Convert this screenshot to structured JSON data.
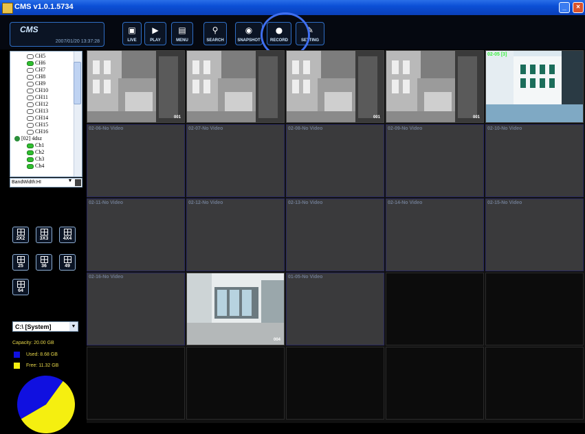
{
  "window": {
    "title": "CMS v1.0.1.5734"
  },
  "header": {
    "logo": "CMS",
    "datetime": "2007/01/20 13:37:28",
    "buttons": [
      {
        "label": "LIVE",
        "icon": "tv-icon"
      },
      {
        "label": "PLAY",
        "icon": "play-icon"
      },
      {
        "label": "MENU",
        "icon": "menu-icon"
      },
      {
        "label": "SEARCH",
        "icon": "search-icon"
      },
      {
        "label": "SNAPSHOT",
        "icon": "eye-icon"
      },
      {
        "label": "RECORD",
        "icon": "record-icon"
      },
      {
        "label": "SETTING",
        "icon": "settings-icon"
      }
    ]
  },
  "tree": {
    "items": [
      {
        "label": "CH5",
        "green": false
      },
      {
        "label": "CH6",
        "green": true
      },
      {
        "label": "CH7",
        "green": false
      },
      {
        "label": "CH8",
        "green": false
      },
      {
        "label": "CH9",
        "green": false
      },
      {
        "label": "CH10",
        "green": false
      },
      {
        "label": "CH11",
        "green": false
      },
      {
        "label": "CH12",
        "green": false
      },
      {
        "label": "CH13",
        "green": false
      },
      {
        "label": "CH14",
        "green": false
      },
      {
        "label": "CH15",
        "green": false
      },
      {
        "label": "CH16",
        "green": false
      },
      {
        "label": "[02] 4dsz",
        "dvr": true
      },
      {
        "label": "Ch1",
        "green": true
      },
      {
        "label": "Ch2",
        "green": true
      },
      {
        "label": "Ch3",
        "green": true
      },
      {
        "label": "Ch4",
        "green": true
      }
    ]
  },
  "bandwidth": {
    "label": "BandWidth:",
    "value": "HI"
  },
  "layout_buttons": [
    {
      "label": "2X2"
    },
    {
      "label": "3X3"
    },
    {
      "label": "4X4"
    },
    {
      "label": "25"
    },
    {
      "label": "36"
    },
    {
      "label": "49"
    },
    {
      "label": "64"
    }
  ],
  "drive": {
    "value": "C:\\ [System]"
  },
  "storage": {
    "capacity": "Capacity: 20.00 GB",
    "used": "Used: 8.68 GB",
    "free": "Free: 11.32 GB",
    "used_value": 8.68,
    "free_value": 11.32,
    "used_color": "#1010e0",
    "free_color": "#f5ef10"
  },
  "cells": [
    {
      "label": "",
      "type": "video",
      "num": "001"
    },
    {
      "label": "",
      "type": "video",
      "num": "",
      "selected": true
    },
    {
      "label": "",
      "type": "video",
      "num": "001"
    },
    {
      "label": "",
      "type": "video",
      "num": "001"
    },
    {
      "label": "02-05 [3]",
      "type": "video2",
      "num": ""
    },
    {
      "label": "02-06-No Video",
      "type": "nv"
    },
    {
      "label": "02-07-No Video",
      "type": "nv"
    },
    {
      "label": "02-08-No Video",
      "type": "nv"
    },
    {
      "label": "02-09-No Video",
      "type": "nv"
    },
    {
      "label": "02-10-No Video",
      "type": "nv"
    },
    {
      "label": "02-11-No Video",
      "type": "nv"
    },
    {
      "label": "02-12-No Video",
      "type": "nv"
    },
    {
      "label": "02-13-No Video",
      "type": "nv"
    },
    {
      "label": "02-14-No Video",
      "type": "nv"
    },
    {
      "label": "02-15-No Video",
      "type": "nv"
    },
    {
      "label": "02-16-No Video",
      "type": "nv"
    },
    {
      "label": "",
      "type": "video3",
      "num": "004"
    },
    {
      "label": "01-05-No Video",
      "type": "nv"
    },
    {
      "label": "",
      "type": "empty"
    },
    {
      "label": "",
      "type": "empty"
    },
    {
      "label": "",
      "type": "empty"
    },
    {
      "label": "",
      "type": "empty"
    },
    {
      "label": "",
      "type": "empty"
    },
    {
      "label": "",
      "type": "empty"
    },
    {
      "label": "",
      "type": "empty"
    }
  ]
}
